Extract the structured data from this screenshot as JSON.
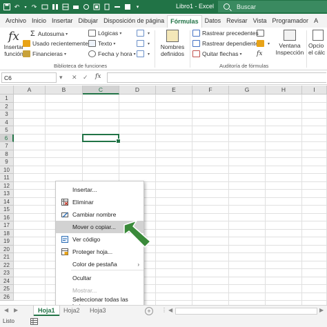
{
  "titlebar": {
    "doc_title": "Libro1 - Excel",
    "search_placeholder": "Buscar",
    "quick_access": [
      "save-icon",
      "undo-icon",
      "redo-icon",
      "qa-icon-1",
      "qa-icon-2",
      "qa-icon-3",
      "qa-icon-4",
      "qa-icon-5",
      "qa-icon-6",
      "qa-icon-7",
      "qa-icon-8",
      "qa-icon-9",
      "customize-icon"
    ]
  },
  "tabs": [
    "Archivo",
    "Inicio",
    "Insertar",
    "Dibujar",
    "Disposición de página",
    "Fórmulas",
    "Datos",
    "Revisar",
    "Vista",
    "Programador",
    "A"
  ],
  "active_tab": "Fórmulas",
  "ribbon": {
    "insert_function": "Insertar\nfunción",
    "autosum": "Autosuma",
    "recent": "Usado recientemente",
    "financial": "Financieras",
    "logical": "Lógicas",
    "text": "Texto",
    "datetime": "Fecha y hora",
    "defined_names": "Nombres\ndefinidos",
    "trace_precedents": "Rastrear precedentes",
    "trace_dependents": "Rastrear dependientes",
    "remove_arrows": "Quitar flechas",
    "fx_symbol": "fx",
    "watch_window": "Ventana\nInspección",
    "calc_options": "Opcio\nel cálc",
    "group_library": "Biblioteca de funciones",
    "group_audit": "Auditoría de fórmulas"
  },
  "formula_bar": {
    "name_box": "C6",
    "cancel": "✕",
    "enter": "✓",
    "fx": "fx",
    "value": ""
  },
  "grid": {
    "columns": [
      "A",
      "B",
      "C",
      "D",
      "E",
      "F",
      "G",
      "H",
      "I"
    ],
    "rows": [
      "1",
      "2",
      "3",
      "4",
      "5",
      "6",
      "7",
      "8",
      "9",
      "10",
      "11",
      "12",
      "13",
      "14",
      "15",
      "16",
      "17",
      "18",
      "19",
      "20",
      "21",
      "22",
      "23",
      "24",
      "25",
      "26"
    ],
    "selected_cell": "C6"
  },
  "context_menu": {
    "items": [
      {
        "label": "Insertar...",
        "icon": "",
        "state": "normal"
      },
      {
        "label": "Eliminar",
        "icon": "delete-sheet-icon",
        "state": "normal"
      },
      {
        "label": "Cambiar nombre",
        "icon": "rename-icon",
        "state": "normal"
      },
      {
        "label": "Mover o copiar...",
        "icon": "",
        "state": "highlighted"
      },
      {
        "label": "Ver código",
        "icon": "view-code-icon",
        "state": "normal"
      },
      {
        "label": "Proteger hoja...",
        "icon": "protect-sheet-icon",
        "state": "normal"
      },
      {
        "label": "Color de pestaña",
        "icon": "",
        "state": "submenu"
      },
      {
        "label": "Ocultar",
        "icon": "",
        "state": "normal"
      },
      {
        "label": "Mostrar...",
        "icon": "",
        "state": "disabled"
      },
      {
        "label": "Seleccionar todas las hojas",
        "icon": "",
        "state": "normal"
      }
    ],
    "submenu_arrow": "›"
  },
  "sheets": {
    "active": "Hoja1",
    "others": [
      "Hoja2",
      "Hoja3"
    ],
    "add": "+"
  },
  "status": {
    "label": "Listo"
  },
  "colors": {
    "accent": "#217346",
    "arrow": "#3a8a3a"
  }
}
